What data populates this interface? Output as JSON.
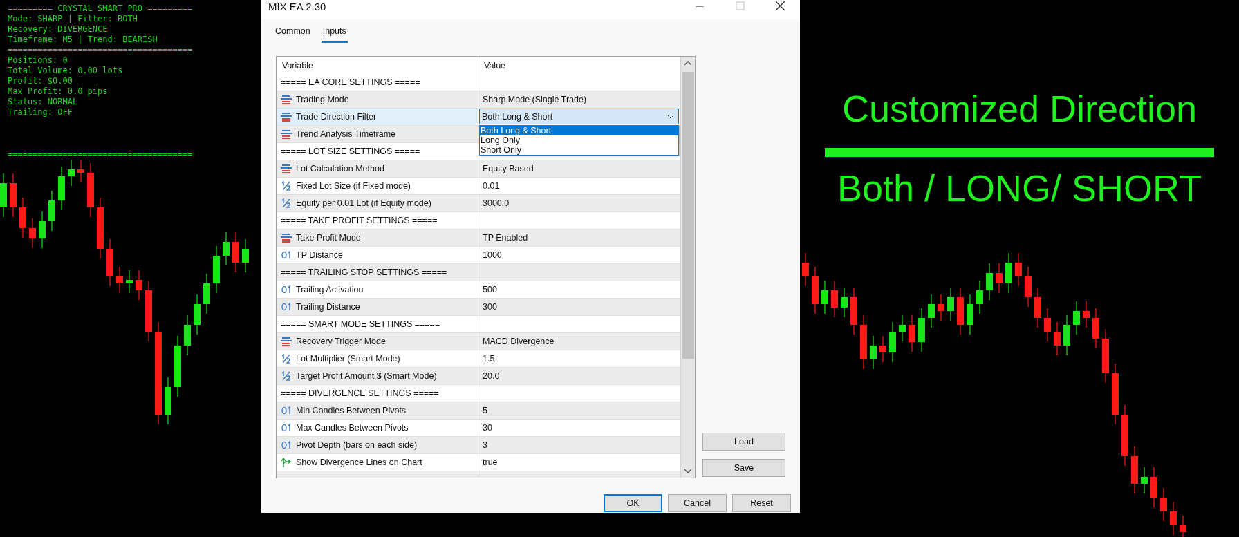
{
  "overlay": {
    "lines": [
      "========= CRYSTAL SMART PRO =========",
      "Mode: SHARP | Filter: BOTH",
      "Recovery: DIVERGENCE",
      "Timeframe: M5 | Trend: BEARISH",
      "=====================================",
      "Positions: 0",
      "Total Volume: 0.00 lots",
      "Profit: $0.00",
      "Max Profit: 0.0 pips",
      "Status: NORMAL",
      "Trailing: OFF"
    ],
    "footer": "====================================="
  },
  "window": {
    "title": "MIX EA 2.30"
  },
  "tabs": [
    {
      "label": "Common",
      "selected": false
    },
    {
      "label": "Inputs",
      "selected": true
    }
  ],
  "table": {
    "columns": [
      "Variable",
      "Value"
    ],
    "rows": [
      {
        "kind": "section",
        "variable": "===== EA CORE SETTINGS =====",
        "selected": false
      },
      {
        "kind": "enum",
        "variable": "Trading Mode",
        "value": "Sharp Mode (Single Trade)",
        "selected": false
      },
      {
        "kind": "enum",
        "variable": "Trade Direction Filter",
        "value": "Both Long & Short",
        "selected": true,
        "expanded": true,
        "options": [
          {
            "label": "Both Long & Short",
            "selected": true
          },
          {
            "label": "Long Only",
            "selected": false
          },
          {
            "label": "Short Only",
            "selected": false
          }
        ]
      },
      {
        "kind": "enum",
        "variable": "Trend Analysis Timeframe",
        "selected": false
      },
      {
        "kind": "section",
        "variable": "===== LOT SIZE SETTINGS =====",
        "selected": false
      },
      {
        "kind": "enum",
        "variable": "Lot Calculation Method",
        "value": "Equity Based",
        "selected": false
      },
      {
        "kind": "double",
        "variable": "Fixed Lot Size (if Fixed mode)",
        "value": "0.01",
        "selected": false
      },
      {
        "kind": "double",
        "variable": "Equity per 0.01 Lot (if Equity mode)",
        "value": "3000.0",
        "selected": false
      },
      {
        "kind": "section",
        "variable": "===== TAKE PROFIT SETTINGS =====",
        "selected": false
      },
      {
        "kind": "enum",
        "variable": "Take Profit Mode",
        "value": "TP Enabled",
        "selected": false
      },
      {
        "kind": "int",
        "variable": "TP Distance",
        "value": "1000",
        "selected": false
      },
      {
        "kind": "section",
        "variable": "===== TRAILING STOP SETTINGS =====",
        "selected": false
      },
      {
        "kind": "int",
        "variable": "Trailing Activation",
        "value": "500",
        "selected": false
      },
      {
        "kind": "int",
        "variable": "Trailing Distance",
        "value": "300",
        "selected": false
      },
      {
        "kind": "section",
        "variable": "===== SMART MODE SETTINGS =====",
        "selected": false
      },
      {
        "kind": "enum",
        "variable": "Recovery Trigger Mode",
        "value": "MACD Divergence",
        "selected": false
      },
      {
        "kind": "double",
        "variable": "Lot Multiplier (Smart Mode)",
        "value": "1.5",
        "selected": false
      },
      {
        "kind": "double",
        "variable": "Target Profit Amount $ (Smart Mode)",
        "value": "20.0",
        "selected": false
      },
      {
        "kind": "section",
        "variable": "===== DIVERGENCE SETTINGS =====",
        "selected": false
      },
      {
        "kind": "int",
        "variable": "Min Candles Between Pivots",
        "value": "5",
        "selected": false
      },
      {
        "kind": "int",
        "variable": "Max Candles Between Pivots",
        "value": "30",
        "selected": false
      },
      {
        "kind": "int",
        "variable": "Pivot Depth (bars on each side)",
        "value": "3",
        "selected": false
      },
      {
        "kind": "bool",
        "variable": "Show Divergence Lines on Chart",
        "value": "true",
        "selected": false
      }
    ]
  },
  "side_buttons": [
    "Load",
    "Save"
  ],
  "buttons": [
    {
      "label": "OK",
      "default": true
    },
    {
      "label": "Cancel",
      "default": false
    },
    {
      "label": "Reset",
      "default": false
    }
  ],
  "banner": {
    "title": "Customized Direction",
    "subtitle": "Both / LONG/ SHORT"
  }
}
